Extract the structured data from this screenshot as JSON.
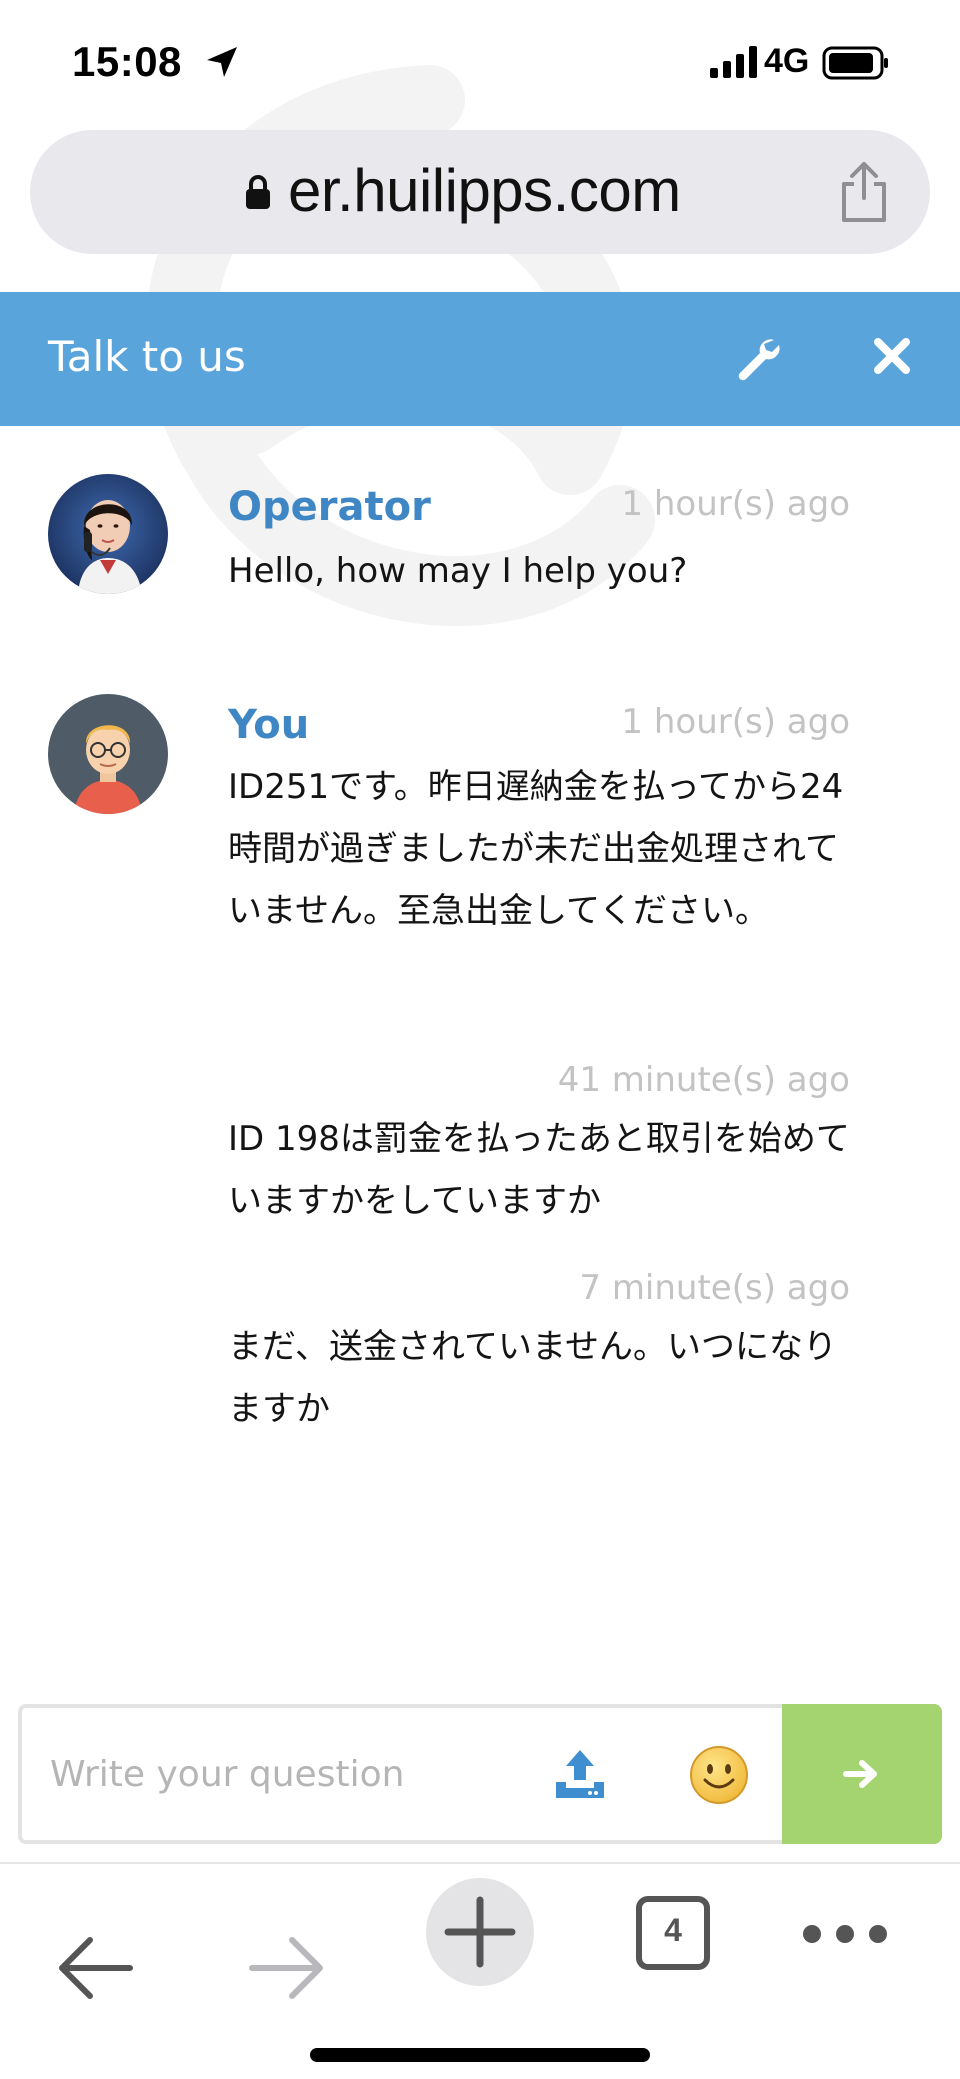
{
  "status_bar": {
    "time": "15:08",
    "network": "4G",
    "icons": [
      "location-arrow-icon",
      "signal-bars-icon",
      "battery-icon"
    ]
  },
  "browser": {
    "url": "er.huilipps.com",
    "icons": [
      "lock-icon",
      "share-icon"
    ]
  },
  "chat": {
    "title": "Talk to us",
    "header_icons": [
      "wrench-icon",
      "close-icon"
    ],
    "messages": [
      {
        "author": "Operator",
        "time": "1 hour(s) ago",
        "text": "Hello, how may I help you?"
      },
      {
        "author": "You",
        "time": "1 hour(s) ago",
        "text": "ID251です。昨日遅納金を払ってから24時間が過ぎましたが未だ出金処理されていません。至急出金してください。"
      },
      {
        "author": "",
        "time": "41 minute(s) ago",
        "text": "ID 198は罰金を払ったあと取引を始めていますかをしていますか"
      },
      {
        "author": "",
        "time": "7 minute(s) ago",
        "text": "まだ、送金されていません。いつになりますか"
      }
    ]
  },
  "composer": {
    "placeholder": "Write your question",
    "icons": [
      "upload-icon",
      "smiley-emoji-icon",
      "send-arrow-icon"
    ]
  },
  "bottom_bar": {
    "tab_count": "4",
    "icons": [
      "back-arrow-icon",
      "forward-arrow-icon",
      "plus-icon",
      "more-dots-icon"
    ]
  },
  "colors": {
    "header_blue": "#5aa4dc",
    "name_blue": "#3f86c4",
    "send_green": "#a3d46f",
    "timestamp_gray": "#c3c3c3"
  }
}
